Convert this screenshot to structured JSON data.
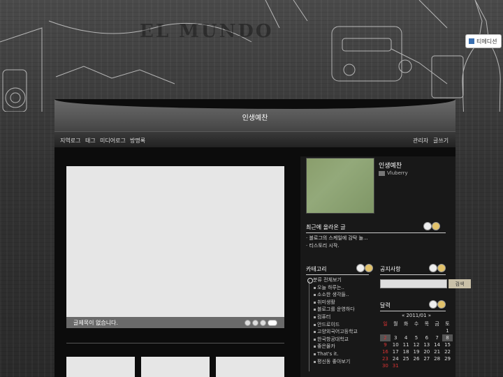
{
  "edition_badge": {
    "label": "티에디션"
  },
  "background": {
    "newsprint": "EL MUNDO",
    "radio_label": "RADIO"
  },
  "blog": {
    "title": "인생예찬"
  },
  "menu": {
    "left": [
      "지역로그",
      "태그",
      "미디어로그",
      "방명록"
    ],
    "right": [
      "관리자",
      "글쓰기"
    ]
  },
  "featured": {
    "caption": "글제목이 없습니다."
  },
  "profile": {
    "name": "인생예찬",
    "user": "Vluberry"
  },
  "recent_posts": {
    "title": "최근에 올라온 글",
    "items": [
      "· 블로그의 스케일에 감탁 놀...",
      "· 티스토리 시작."
    ]
  },
  "categories": {
    "title": "카테고리",
    "root": "분류 전체보기",
    "items": [
      "오늘 하루는..",
      "소소한 생각들..",
      "취미생활",
      "블로그를 운영하다",
      "컴퓨터",
      "안드로이드",
      "고양외국어고등학교",
      "한국항공대학교",
      "좋은물카",
      "That's it.",
      "평신동 좋아보기"
    ]
  },
  "notice": {
    "title": "공지사항"
  },
  "search": {
    "placeholder": "",
    "button": "검색"
  },
  "calendar": {
    "title": "달력",
    "month": "« 2011/01 »",
    "weekdays": [
      "일",
      "월",
      "화",
      "수",
      "목",
      "금",
      "토"
    ],
    "weeks": [
      [
        "",
        "",
        "",
        "",
        "",
        "",
        "1"
      ],
      [
        "2",
        "3",
        "4",
        "5",
        "6",
        "7",
        "8"
      ],
      [
        "9",
        "10",
        "11",
        "12",
        "13",
        "14",
        "15"
      ],
      [
        "16",
        "17",
        "18",
        "19",
        "20",
        "21",
        "22"
      ],
      [
        "23",
        "24",
        "25",
        "26",
        "27",
        "28",
        "29"
      ],
      [
        "30",
        "31",
        "",
        "",
        "",
        "",
        ""
      ]
    ]
  },
  "colors": {
    "accent": "#c9c0a8",
    "sunday": "#dd3333"
  }
}
